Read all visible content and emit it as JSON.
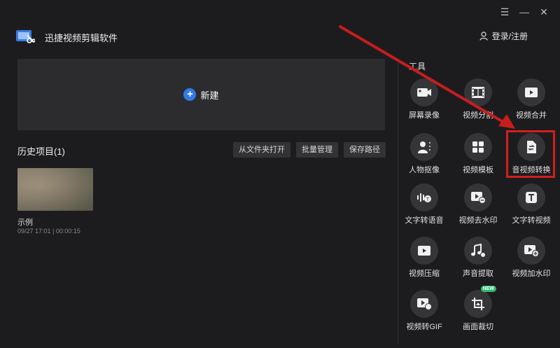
{
  "window": {
    "controls": [
      "menu-icon",
      "minimize-icon",
      "close-icon"
    ]
  },
  "header": {
    "app_title": "迅捷视频剪辑软件",
    "login_label": "登录/注册"
  },
  "new_project": {
    "label": "新建"
  },
  "history": {
    "title": "历史项目(1)",
    "actions": [
      "从文件夹打开",
      "批量管理",
      "保存路径"
    ],
    "items": [
      {
        "name": "示例",
        "meta": "09/27 17:01 | 00:00:15"
      }
    ]
  },
  "tools": {
    "title": "工具",
    "items": [
      {
        "label": "屏幕录像",
        "icon": "screen-record-icon"
      },
      {
        "label": "视频分割",
        "icon": "film-split-icon"
      },
      {
        "label": "视频合并",
        "icon": "video-merge-icon"
      },
      {
        "label": "人物抠像",
        "icon": "person-cutout-icon"
      },
      {
        "label": "视频模板",
        "icon": "template-grid-icon"
      },
      {
        "label": "音视频转换",
        "icon": "av-convert-icon"
      },
      {
        "label": "文字转语音",
        "icon": "text-to-speech-icon"
      },
      {
        "label": "视频去水印",
        "icon": "remove-watermark-icon"
      },
      {
        "label": "文字转视频",
        "icon": "text-to-video-icon"
      },
      {
        "label": "视频压缩",
        "icon": "video-compress-icon"
      },
      {
        "label": "声音提取",
        "icon": "audio-extract-icon"
      },
      {
        "label": "视频加水印",
        "icon": "add-watermark-icon"
      },
      {
        "label": "视频转GIF",
        "icon": "video-to-gif-icon"
      },
      {
        "label": "画面裁切",
        "icon": "crop-icon",
        "badge": "NEW"
      }
    ]
  },
  "colors": {
    "accent": "#2f7ae8",
    "annotation": "#d21e1e",
    "badge": "#2dbd6e"
  }
}
